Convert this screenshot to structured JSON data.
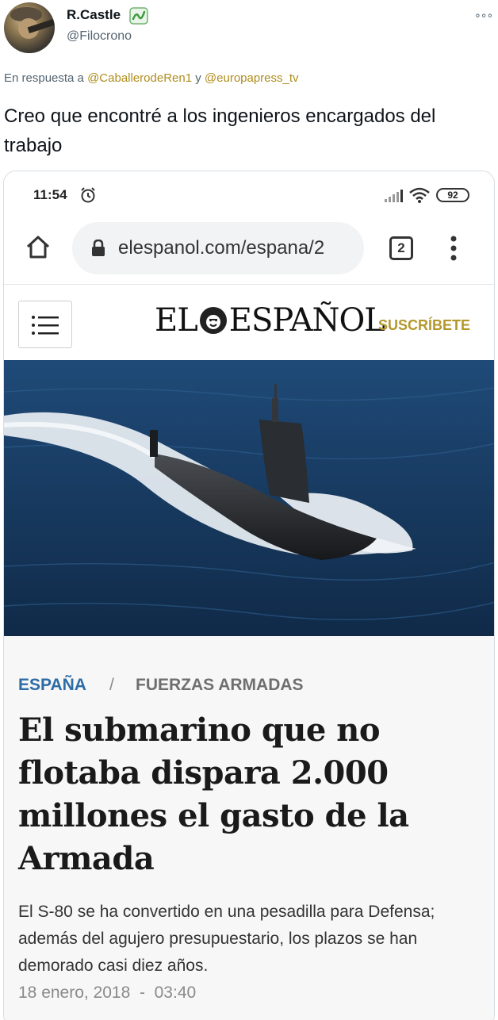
{
  "tweet": {
    "display_name": "R.Castle",
    "handle": "@Filocrono",
    "reply_prefix": "En respuesta a",
    "reply_mention_1": "@CaballerodeRen1",
    "reply_joiner": "y",
    "reply_mention_2": "@europapress_tv",
    "text": "Creo que encontré a los ingenieros encargados del trabajo"
  },
  "phone": {
    "status": {
      "time": "11:54",
      "battery": "92"
    },
    "browser": {
      "url": "elespanol.com/espana/2",
      "tab_count": "2"
    }
  },
  "site": {
    "logo_left": "EL",
    "logo_right": "ESPAÑOL",
    "subscribe_label": "SUSCRÍBETE"
  },
  "article": {
    "section_primary": "ESPAÑA",
    "section_separator": "/",
    "section_secondary": "FUERZAS ARMADAS",
    "headline": "El submarino que no flotaba dispara 2.000 millones el gasto de la Armada",
    "summary": "El S-80 se ha convertido en una pesadilla para Defensa; además del agujero presupuestario, los plazos se han demorado casi diez años.",
    "dateline": "18 enero, 2018  -  03:40"
  },
  "colors": {
    "mention": "#b08d1d",
    "section_primary": "#2d6ca6",
    "subscribe": "#b4982d",
    "sea": "#17385f"
  },
  "icons": [
    "more-icon",
    "verified-badge-icon",
    "alarm-icon",
    "signal-icon",
    "wifi-icon",
    "home-icon",
    "lock-icon",
    "tabs-icon",
    "overflow-menu-icon",
    "hamburger-menu-icon",
    "lion-logo-icon"
  ]
}
